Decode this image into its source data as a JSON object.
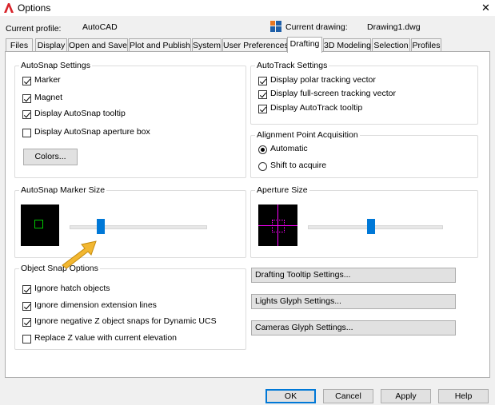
{
  "window": {
    "title": "Options",
    "close_glyph": "✕"
  },
  "profile": {
    "current_profile_label": "Current profile:",
    "current_profile_value": "AutoCAD",
    "current_drawing_label": "Current drawing:",
    "current_drawing_value": "Drawing1.dwg"
  },
  "tabs": [
    {
      "label": "Files"
    },
    {
      "label": "Display"
    },
    {
      "label": "Open and Save"
    },
    {
      "label": "Plot and Publish"
    },
    {
      "label": "System"
    },
    {
      "label": "User Preferences"
    },
    {
      "label": "Drafting",
      "active": true
    },
    {
      "label": "3D Modeling"
    },
    {
      "label": "Selection"
    },
    {
      "label": "Profiles"
    }
  ],
  "autosnap": {
    "title": "AutoSnap Settings",
    "marker": "Marker",
    "magnet": "Magnet",
    "tooltip": "Display AutoSnap tooltip",
    "aperture_box": "Display AutoSnap aperture box",
    "colors_button": "Colors..."
  },
  "autotrack": {
    "title": "AutoTrack Settings",
    "polar": "Display polar tracking vector",
    "fullscreen": "Display full-screen tracking vector",
    "tooltip": "Display AutoTrack tooltip"
  },
  "alignment": {
    "title": "Alignment Point Acquisition",
    "automatic": "Automatic",
    "shift": "Shift to acquire"
  },
  "marker_size": {
    "title": "AutoSnap Marker Size",
    "level": 0.22
  },
  "aperture_size": {
    "title": "Aperture Size",
    "level": 0.47
  },
  "object_snap": {
    "title": "Object Snap Options",
    "ignore_hatch": "Ignore hatch objects",
    "ignore_dimension": "Ignore dimension extension lines",
    "ignore_negative_z": "Ignore negative Z object snaps for Dynamic UCS",
    "replace_z": "Replace Z value with current elevation"
  },
  "buttons": {
    "drafting_tooltip": "Drafting Tooltip Settings...",
    "lights_glyph": "Lights Glyph Settings...",
    "cameras_glyph": "Cameras Glyph Settings...",
    "ok": "OK",
    "cancel": "Cancel",
    "apply": "Apply",
    "help": "Help"
  },
  "colors": {
    "accent": "#0078d7",
    "annotation_arrow": "#f2b731",
    "marker_green": "#00c800",
    "aperture_magenta": "#ff00ff"
  }
}
